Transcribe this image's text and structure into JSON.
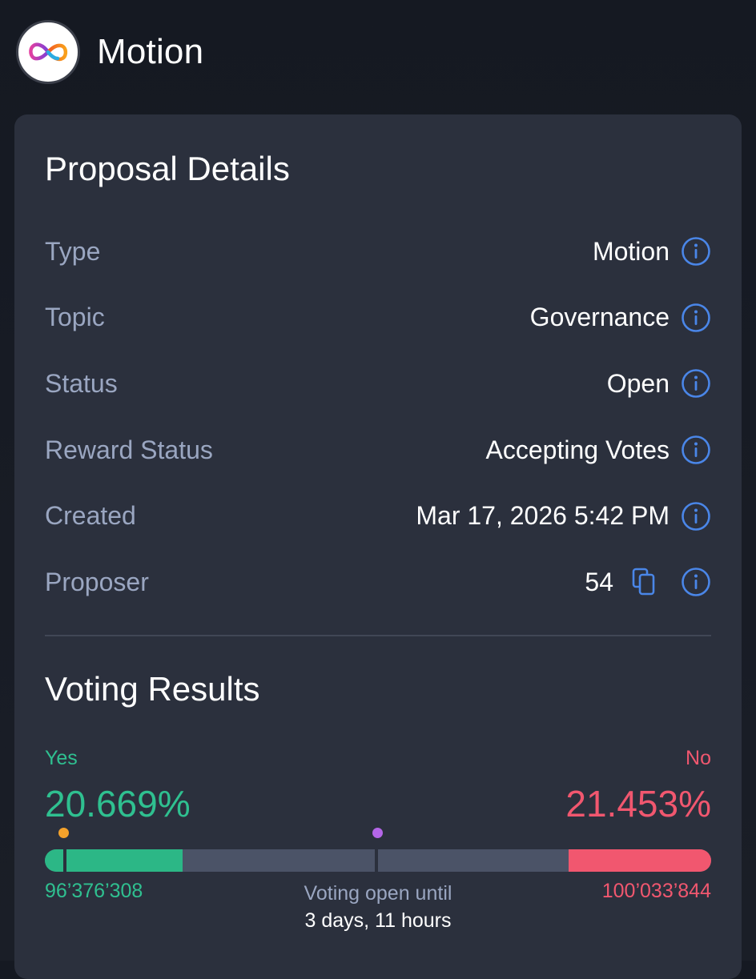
{
  "header": {
    "title": "Motion",
    "logo_icon": "infinity-logo-icon"
  },
  "proposal_details": {
    "title": "Proposal Details",
    "rows": [
      {
        "label": "Type",
        "value": "Motion"
      },
      {
        "label": "Topic",
        "value": "Governance"
      },
      {
        "label": "Status",
        "value": "Open"
      },
      {
        "label": "Reward Status",
        "value": "Accepting Votes"
      },
      {
        "label": "Created",
        "value": "Mar 17, 2026 5:42 PM"
      },
      {
        "label": "Proposer",
        "value": "54"
      }
    ],
    "icons": {
      "info": "info-icon",
      "copy": "copy-icon"
    },
    "accent_color": "#4a86e8"
  },
  "voting_results": {
    "title": "Voting Results",
    "yes": {
      "label": "Yes",
      "percent": "20.669%",
      "count": "96’376’308",
      "color": "#2fc090",
      "fraction": 0.20669
    },
    "no": {
      "label": "No",
      "percent": "21.453%",
      "count": "100’033’844",
      "color": "#f1576f",
      "fraction": 0.21453
    },
    "voting_open_label": "Voting open until",
    "voting_open_remaining": "3 days, 11 hours"
  }
}
